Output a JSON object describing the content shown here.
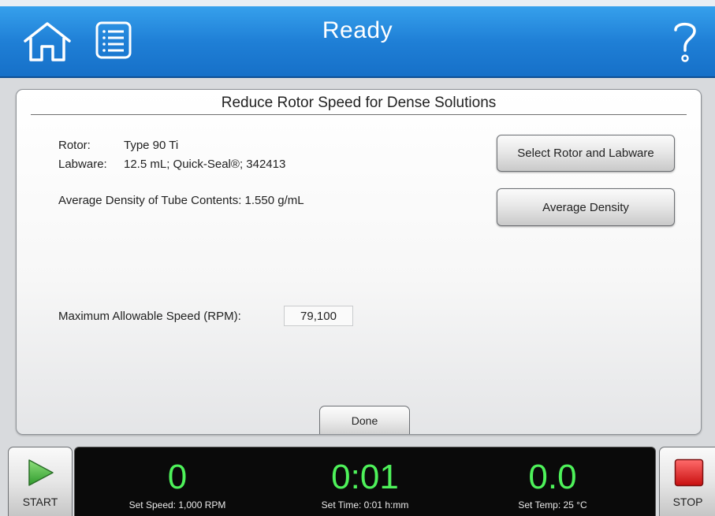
{
  "header": {
    "title": "Ready"
  },
  "panel": {
    "title": "Reduce Rotor Speed for Dense Solutions",
    "rotor_label": "Rotor:",
    "rotor_value": "Type 90 Ti",
    "labware_label": "Labware:",
    "labware_value": "12.5 mL; Quick-Seal®; 342413",
    "density_text": "Average Density of Tube Contents: 1.550 g/mL",
    "select_rotor_button": "Select Rotor and Labware",
    "average_density_button": "Average Density",
    "max_speed_label": "Maximum Allowable Speed (RPM):",
    "max_speed_value": "79,100",
    "done_button": "Done"
  },
  "bottom_bar": {
    "start_label": "START",
    "stop_label": "STOP",
    "speed_value": "0",
    "speed_caption": "Set Speed: 1,000 RPM",
    "time_value": "0:01",
    "time_caption": "Set Time: 0:01 h:mm",
    "temp_value": "0.0",
    "temp_caption": "Set Temp: 25 °C"
  },
  "colors": {
    "header_blue": "#1f7fd6",
    "readout_green": "#4ef25a",
    "start_green": "#3ea83a",
    "stop_red": "#e01818"
  }
}
